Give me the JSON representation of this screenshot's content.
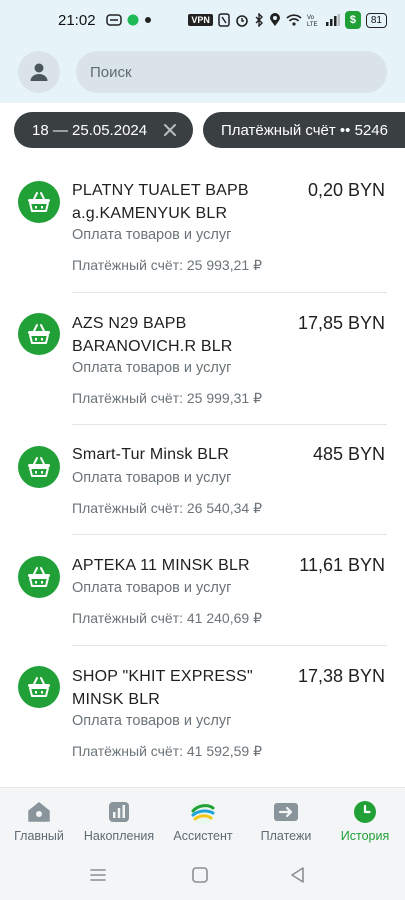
{
  "status_bar": {
    "time": "21:02",
    "vpn": "VPN",
    "carrier_chip": "$",
    "battery": "81"
  },
  "header": {
    "search_placeholder": "Поиск"
  },
  "filters": {
    "date_range": "18 — 25.05.2024",
    "account": "Платёжный счёт •• 5246"
  },
  "transactions": [
    {
      "title": "PLATNY TUALET BAPB a.g.KAMENYUK BLR",
      "amount": "0,20 BYN",
      "category": "Оплата товаров и услуг",
      "balance": "Платёжный счёт: 25 993,21 ₽"
    },
    {
      "title": "AZS N29 BAPB BARANOVICH.R BLR",
      "amount": "17,85 BYN",
      "category": "Оплата товаров и услуг",
      "balance": "Платёжный счёт: 25 999,31 ₽"
    },
    {
      "title": "Smart-Tur Minsk BLR",
      "amount": "485 BYN",
      "category": "Оплата товаров и услуг",
      "balance": "Платёжный счёт: 26 540,34 ₽"
    },
    {
      "title": "APTEKA 11 MINSK BLR",
      "amount": "11,61 BYN",
      "category": "Оплата товаров и услуг",
      "balance": "Платёжный счёт: 41 240,69 ₽"
    },
    {
      "title": "SHOP \"KHIT EXPRESS\" MINSK BLR",
      "amount": "17,38 BYN",
      "category": "Оплата товаров и услуг",
      "balance": "Платёжный счёт: 41 592,59 ₽"
    }
  ],
  "bottom_nav": [
    {
      "label": "Главный",
      "icon": "home-icon"
    },
    {
      "label": "Накопления",
      "icon": "savings-chart-icon"
    },
    {
      "label": "Ассистент",
      "icon": "assistant-logo-icon"
    },
    {
      "label": "Платежи",
      "icon": "payments-arrow-icon"
    },
    {
      "label": "История",
      "icon": "history-clock-icon",
      "active": true
    }
  ],
  "colors": {
    "accent_green": "#21a038",
    "header_bg": "#e6f4fa",
    "chip_bg": "#3a3f42"
  }
}
